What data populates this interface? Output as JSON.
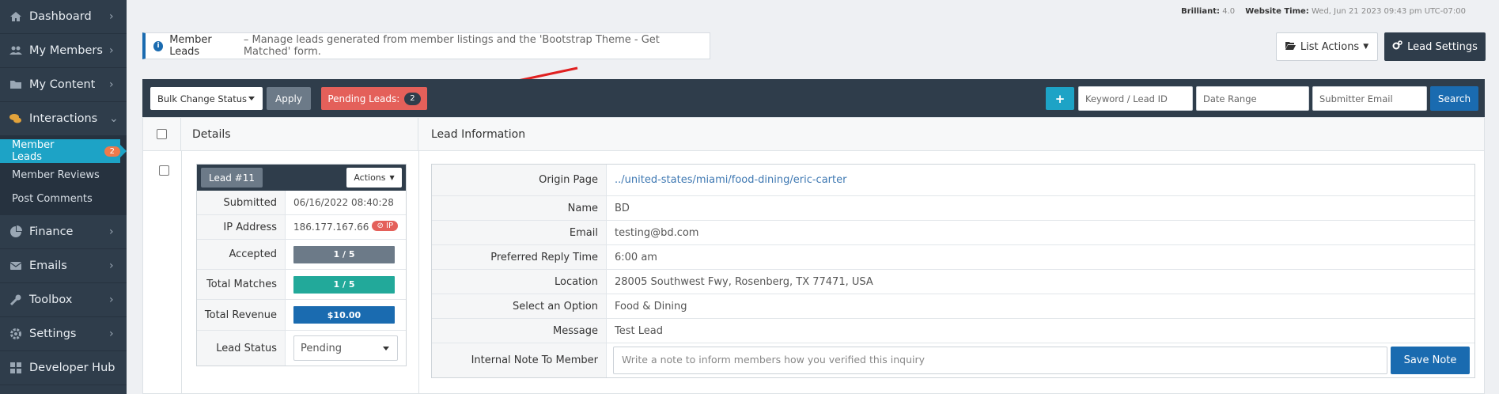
{
  "sidebar": {
    "items": [
      {
        "label": "Dashboard",
        "icon": "home-icon"
      },
      {
        "label": "My Members",
        "icon": "users-icon"
      },
      {
        "label": "My Content",
        "icon": "folder-icon"
      },
      {
        "label": "Interactions",
        "icon": "comments-icon"
      },
      {
        "label": "Finance",
        "icon": "pie-chart-icon"
      },
      {
        "label": "Emails",
        "icon": "envelope-icon"
      },
      {
        "label": "Toolbox",
        "icon": "wrench-icon"
      },
      {
        "label": "Settings",
        "icon": "gear-icon"
      },
      {
        "label": "Developer Hub",
        "icon": "grid-icon"
      }
    ],
    "submenu": [
      {
        "label": "Member Leads",
        "badge": "2"
      },
      {
        "label": "Member Reviews"
      },
      {
        "label": "Post Comments"
      }
    ]
  },
  "topinfo": {
    "brilliant_label": "Brilliant:",
    "brilliant_value": "4.0",
    "time_label": "Website Time:",
    "time_value": "Wed, Jun 21 2023 09:43 pm UTC-07:00"
  },
  "intro": {
    "title": "Member Leads",
    "text": "– Manage leads generated from member listings and the 'Bootstrap Theme - Get Matched' form."
  },
  "header_buttons": {
    "list_actions": "List Actions",
    "lead_settings": "Lead Settings"
  },
  "toolbar": {
    "bulk_label": "Bulk Change Status",
    "apply_label": "Apply",
    "pending_label": "Pending Leads:",
    "pending_count": "2",
    "plus_label": "+",
    "keyword_placeholder": "Keyword / Lead ID",
    "date_placeholder": "Date Range",
    "email_placeholder": "Submitter Email",
    "search_label": "Search"
  },
  "table": {
    "col_details": "Details",
    "col_info": "Lead Information"
  },
  "lead": {
    "id_label": "Lead #11",
    "actions_label": "Actions",
    "submitted_label": "Submitted",
    "submitted_value": "06/16/2022 08:40:28",
    "ip_label": "IP Address",
    "ip_value": "186.177.167.66",
    "ip_badge": "IP",
    "accepted_label": "Accepted",
    "accepted_value": "1 / 5",
    "matches_label": "Total Matches",
    "matches_value": "1 / 5",
    "revenue_label": "Total Revenue",
    "revenue_value": "$10.00",
    "status_label": "Lead Status",
    "status_value": "Pending"
  },
  "info": {
    "rows": [
      {
        "label": "Origin Page",
        "value": "../united-states/miami/food-dining/eric-carter"
      },
      {
        "label": "Name",
        "value": "BD"
      },
      {
        "label": "Email",
        "value": "testing@bd.com"
      },
      {
        "label": "Preferred Reply Time",
        "value": "6:00 am"
      },
      {
        "label": "Location",
        "value": "28005 Southwest Fwy, Rosenberg, TX 77471, USA"
      },
      {
        "label": "Select an Option",
        "value": "Food & Dining"
      },
      {
        "label": "Message",
        "value": "Test Lead"
      }
    ],
    "note_label": "Internal Note To Member",
    "note_placeholder": "Write a note to inform members how you verified this inquiry",
    "save_label": "Save Note"
  },
  "colors": {
    "sidebar_bg": "#2f3d4b",
    "accent_blue": "#1a6bb0",
    "teal": "#1da3c6",
    "pending_red": "#e4605a",
    "matches_green": "#22a99a",
    "accepted_gray": "#6c7a88"
  }
}
